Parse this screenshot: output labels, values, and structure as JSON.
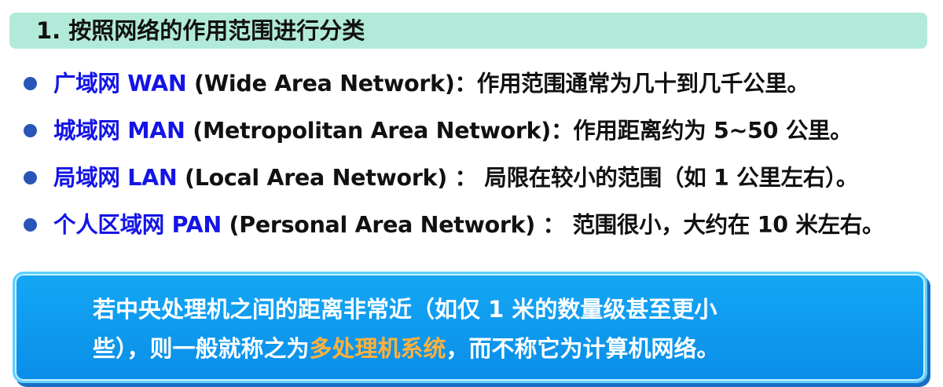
{
  "header": {
    "title": "1. 按照网络的作用范围进行分类"
  },
  "bullets": [
    {
      "term": "广域网 WAN",
      "text": " (Wide Area Network)：作用范围通常为几十到几千公里。"
    },
    {
      "term": "城域网 MAN",
      "text": " (Metropolitan Area Network)：作用距离约为 5~50 公里。"
    },
    {
      "term": "局域网 LAN",
      "text": " (Local Area Network) ： 局限在较小的范围（如 1 公里左右）。"
    },
    {
      "term": "个人区域网 PAN",
      "text": " (Personal Area Network) ： 范围很小，大约在 10 米左右。"
    }
  ],
  "callout": {
    "line1": "若中央处理机之间的距离非常近（如仅 1 米的数量级甚至更小",
    "line2_before": "些），则一般就称之为",
    "line2_highlight": "多处理机系统",
    "line2_after": "，而不称它为计算机网络。"
  },
  "colors": {
    "header_bg": "#b2ead9",
    "term_blue": "#1414e6",
    "bullet_dot": "#2a55b8",
    "callout_bg": "#0a8ee8",
    "highlight_orange": "#ffb13d"
  }
}
